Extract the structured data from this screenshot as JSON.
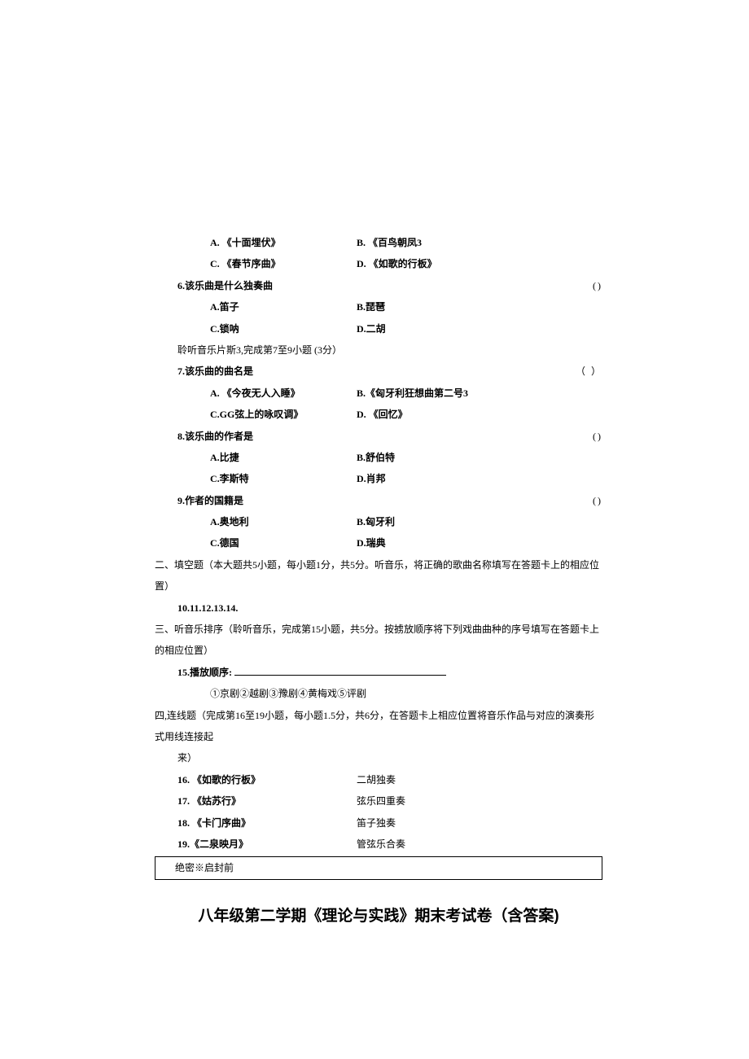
{
  "q5_options": {
    "a": "A. 《十面埋伏》",
    "b": "B. 《百鸟朝凤3",
    "c": "C. 《春节序曲》",
    "d": "D. 《如歌的行板》"
  },
  "q6": {
    "stem": "6.该乐曲是什么独奏曲",
    "paren": "()",
    "a": "A.笛子",
    "b": "B.琵琶",
    "c": "C.锁呐",
    "d": "D.二胡"
  },
  "listen3": "聆听音乐片斯3,完成第7至9小题  (3分）",
  "q7": {
    "stem": "7.该乐曲的曲名是",
    "paren": "（    ）",
    "a": "A. 《今夜无人入睡》",
    "b": "B.《匈牙利狂想曲第二号3",
    "c": "C.GG弦上的咏叹调》",
    "d": "D. 《回忆》"
  },
  "q8": {
    "stem": "8.该乐曲的作者是",
    "paren": "()",
    "a": "A.比捷",
    "b": "B.舒伯特",
    "c": "C.李斯特",
    "d": "D.肖邦"
  },
  "q9": {
    "stem": "9.作者的国籍是",
    "paren": "()",
    "a": "A.奥地利",
    "b": "B.匈牙利",
    "c": "C.德国",
    "d": "D.瑞典"
  },
  "section2": "二、填空题（本大题共5小题，每小题1分，共5分。听音乐，将正确的歌曲名称填写在答题卡上的相应位置）",
  "q10_14": "10.11.12.13.14.",
  "section3": "三、听音乐排序（聆听音乐，完成第15小题，共5分。按掳放顺序将下列戏曲曲种的序号填写在答题卡上的相应位置）",
  "q15": "15.播放顺序:  ",
  "q15_items": "①京剧②越剧③豫剧④黄梅戏⑤评剧",
  "section4": "四,连线题（完成第16至19小题，每小题1.5分，共6分，在答题卡上相应位置将音乐作品与对应的演奏形式用线连接起",
  "section4_cont": "来）",
  "q16": {
    "left": "16. 《如歌的行板》",
    "right": "二胡独奏"
  },
  "q17": {
    "left": "17. 《姑苏行》",
    "right": "弦乐四重奏"
  },
  "q18": {
    "left": "18. 《卡门序曲》",
    "right": "笛子独奏"
  },
  "q19": {
    "left": "19.《二泉映月》",
    "right": "管弦乐合奏"
  },
  "sealed": "绝密※启封前",
  "title": "八年级第二学期《理论与实践》期末考试卷（含答案)"
}
